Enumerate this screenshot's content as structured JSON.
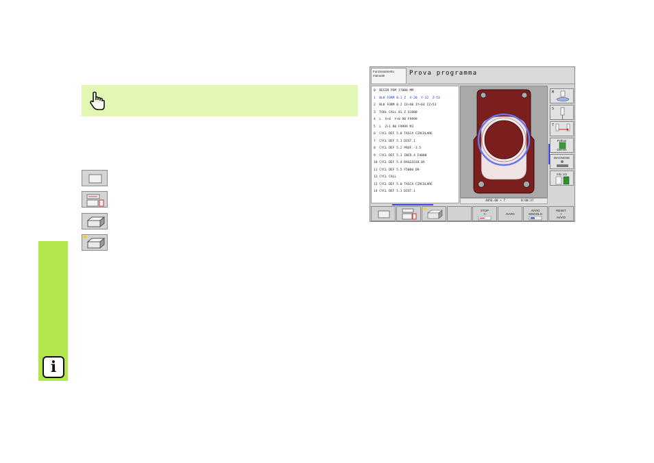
{
  "page": {
    "info_symbol": "i",
    "note_icon": "pointing-hand-icon",
    "left_buttons": [
      {
        "icon": "single-window-icon"
      },
      {
        "icon": "split-window-icon"
      },
      {
        "icon": "3d-block-icon"
      },
      {
        "icon": "3d-block-highlight-icon"
      }
    ],
    "colors": {
      "accent_green": "#b3e64a",
      "note_green": "#e3f7b5"
    }
  },
  "screen": {
    "mode_label_1": "Funzionamento",
    "mode_label_2": "manuale",
    "title": "Prova programma",
    "program_lines": [
      "0  BEGIN PGM 17000 MM",
      "1  BLK FORM 0.1 Z  X-20  Y-32  Z-53",
      "2  BLK FORM 0.2 IX+40 IY+64 IZ+53",
      "3  TOOL CALL 81 Z S1000",
      "4  L  X+0  Y+0 R0 F9999",
      "5  L  Z+1 R0 F9999 M3",
      "6  CYCL DEF 5.0 TASCA CIRCOLARE",
      "7  CYCL DEF 5.1 DIST.1",
      "8  CYCL DEF 5.2 PROF.-3.5",
      "9  CYCL DEF 5.3 INCR.4 F4000",
      "10 CYCL DEF 5.4 RAGGIO18.05",
      "11 CYCL DEF 5.5 F5000 DR-",
      "12 CYCL CALL",
      "13 CYCL DEF 5.0 TASCA CIRCOLARE",
      "14 CYCL DEF 5.1 DIST.1"
    ],
    "active_line_index": 1,
    "status_left": "4056.00 + 7",
    "status_right": "0:00:37",
    "vertical_softkeys": [
      {
        "label": "M",
        "icon": "tool-holder-icon"
      },
      {
        "label": "S",
        "icon": "spindle-icon"
      },
      {
        "label": "T",
        "icon": "tool-change-icon"
      },
      {
        "label": "Python",
        "label2": "Demos",
        "icon": "python-icon"
      },
      {
        "label": "DIAGNOSE",
        "icon": "diagnose-icon"
      },
      {
        "label": "Info 1/3",
        "icon": "info-icon"
      }
    ],
    "horizontal_softkeys": [
      {
        "icon": "single-window-icon"
      },
      {
        "icon": "split-window-icon"
      },
      {
        "icon": "3d-block-icon"
      },
      {
        "label": ""
      },
      {
        "label": "STOP",
        "label2": "A"
      },
      {
        "label": "AVVIO"
      },
      {
        "label": "AVVIO",
        "label2": "SINGOLO"
      },
      {
        "label": "RESET",
        "label2": "+",
        "label3": "AVVIO"
      }
    ],
    "part_colors": {
      "body": "#7a1e1e",
      "pocket_ring": "#6677ee",
      "background": "#a9a9a9"
    }
  }
}
